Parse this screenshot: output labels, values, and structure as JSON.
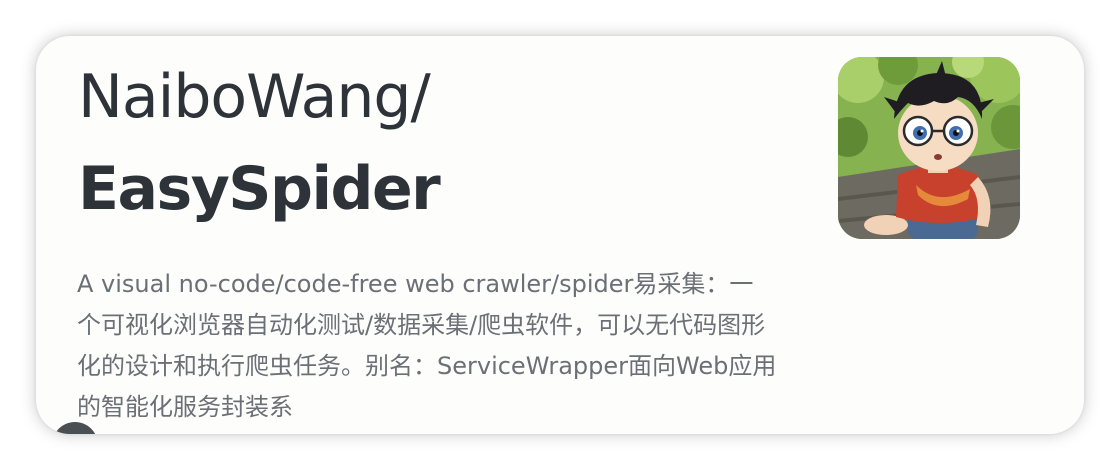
{
  "repo": {
    "owner": "NaiboWang/",
    "name": "EasySpider",
    "description": "A visual no-code/code-free web crawler/spider易采集：一个可视化浏览器自动化测试/数据采集/爬虫软件，可以无代码图形化的设计和执行爬虫任务。别名：ServiceWrapper面向Web应用的智能化服务封装系",
    "avatar_icon": "anime-boy-avatar"
  },
  "colors": {
    "title": "#2d3339",
    "description": "#6b7077",
    "card_background": "#fdfdfb"
  }
}
